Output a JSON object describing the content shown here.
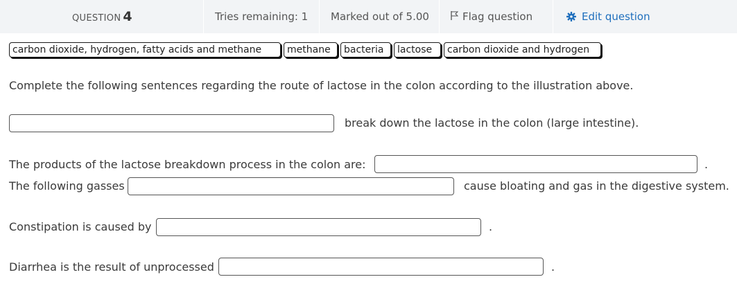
{
  "header": {
    "question_word": "QUESTION",
    "question_number": "4",
    "tries_text": "Tries remaining: 1",
    "marked_text": "Marked out of 5.00",
    "flag_text": "Flag question",
    "edit_text": "Edit question",
    "flag_icon": "flag-icon",
    "edit_icon": "gear-icon",
    "edit_color": "#1f6fbd"
  },
  "choices": [
    "carbon dioxide, hydrogen, fatty acids and methane",
    "methane",
    "bacteria",
    "lactose",
    "carbon dioxide and hydrogen"
  ],
  "instruction": "Complete the following sentences regarding the route of  lactose in the colon according to the illustration above.",
  "sentences": {
    "s1_after": "break down the lactose in the colon (large intestine).",
    "s2_before": "The products of the lactose breakdown process in the colon are:",
    "s2_after": ".",
    "s3_before": "The following gasses",
    "s3_after": "cause bloating and gas in the digestive system.",
    "s4_before": "Constipation is caused by",
    "s4_after": ".",
    "s5_before": "Diarrhea is the result of unprocessed",
    "s5_after": "."
  }
}
